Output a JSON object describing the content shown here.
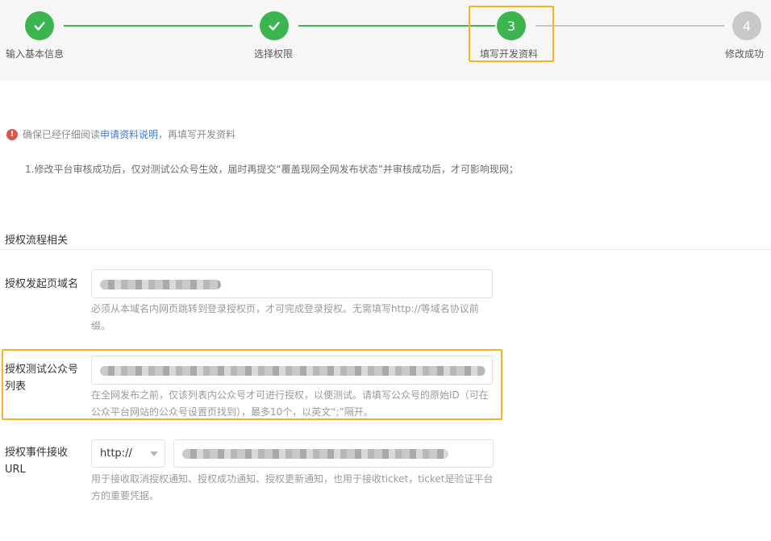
{
  "stepper": {
    "steps": [
      {
        "label": "输入基本信息",
        "state": "done",
        "number": ""
      },
      {
        "label": "选择权限",
        "state": "done",
        "number": ""
      },
      {
        "label": "填写开发资料",
        "state": "active",
        "number": "3"
      },
      {
        "label": "修改成功",
        "state": "pending",
        "number": "4"
      }
    ],
    "colors": {
      "done": "#3cb550",
      "pending": "#c8c8c8",
      "highlight": "#f5b41d"
    }
  },
  "notice": {
    "icon": "warning-icon",
    "prefix": "确保已经仔细阅读",
    "link": "申请资料说明",
    "suffix": "，再填写开发资料"
  },
  "rule_text": "1.修改平台审核成功后，仅对测试公众号生效，届时再提交“覆盖现网全网发布状态”并审核成功后，才可影响现网；",
  "section": {
    "title": "授权流程相关",
    "fields": [
      {
        "label": "授权发起页域名",
        "help": "必须从本域名内网页跳转到登录授权页，才可完成登录授权。无需填写http://等域名协议前缀。"
      },
      {
        "label": "授权测试公众号列表",
        "help": "在全网发布之前，仅该列表内公众号才可进行授权，以便测试。请填写公众号的原始ID（可在公众平台网站的公众号设置页找到），最多10个，以英文“;”隔开。"
      },
      {
        "label": "授权事件接收URL",
        "protocol": "http://",
        "help": "用于接收取消授权通知、授权成功通知、授权更新通知，也用于接收ticket，ticket是验证平台方的重要凭据。"
      }
    ]
  }
}
